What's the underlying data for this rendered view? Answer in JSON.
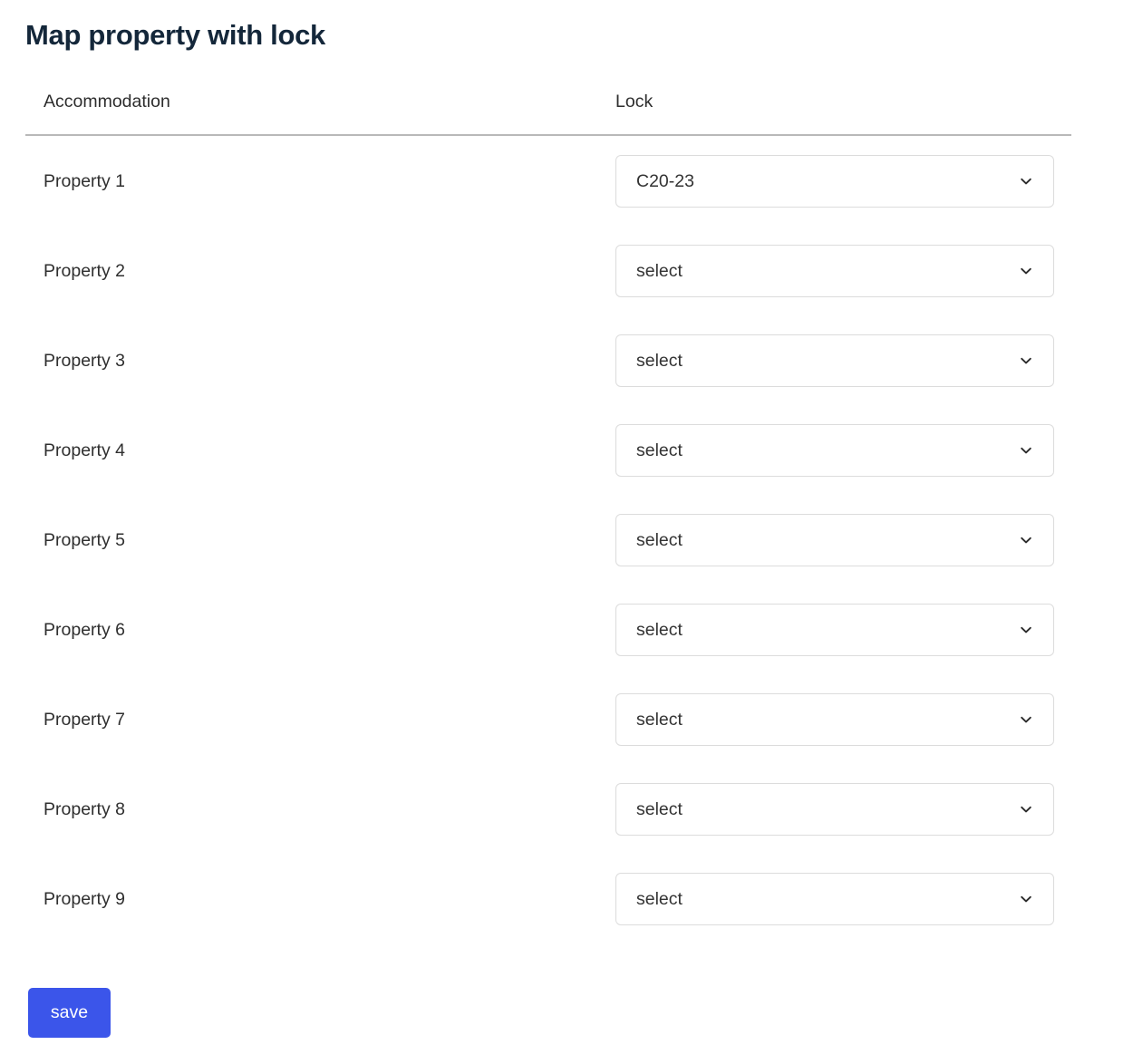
{
  "page": {
    "title": "Map property with lock",
    "title_color": "#14273a",
    "background": "#ffffff"
  },
  "table": {
    "headers": {
      "accommodation": "Accommodation",
      "lock": "Lock"
    },
    "rows": [
      {
        "accommodation": "Property 1",
        "lock_value": "C20-23"
      },
      {
        "accommodation": "Property 2",
        "lock_value": "select"
      },
      {
        "accommodation": "Property 3",
        "lock_value": "select"
      },
      {
        "accommodation": "Property 4",
        "lock_value": "select"
      },
      {
        "accommodation": "Property 5",
        "lock_value": "select"
      },
      {
        "accommodation": "Property 6",
        "lock_value": "select"
      },
      {
        "accommodation": "Property 7",
        "lock_value": "select"
      },
      {
        "accommodation": "Property 8",
        "lock_value": "select"
      },
      {
        "accommodation": "Property 9",
        "lock_value": "select"
      }
    ]
  },
  "actions": {
    "save_label": "save",
    "save_color": "#3b55ea"
  },
  "icons": {
    "chevron": "chevron-down-icon"
  }
}
